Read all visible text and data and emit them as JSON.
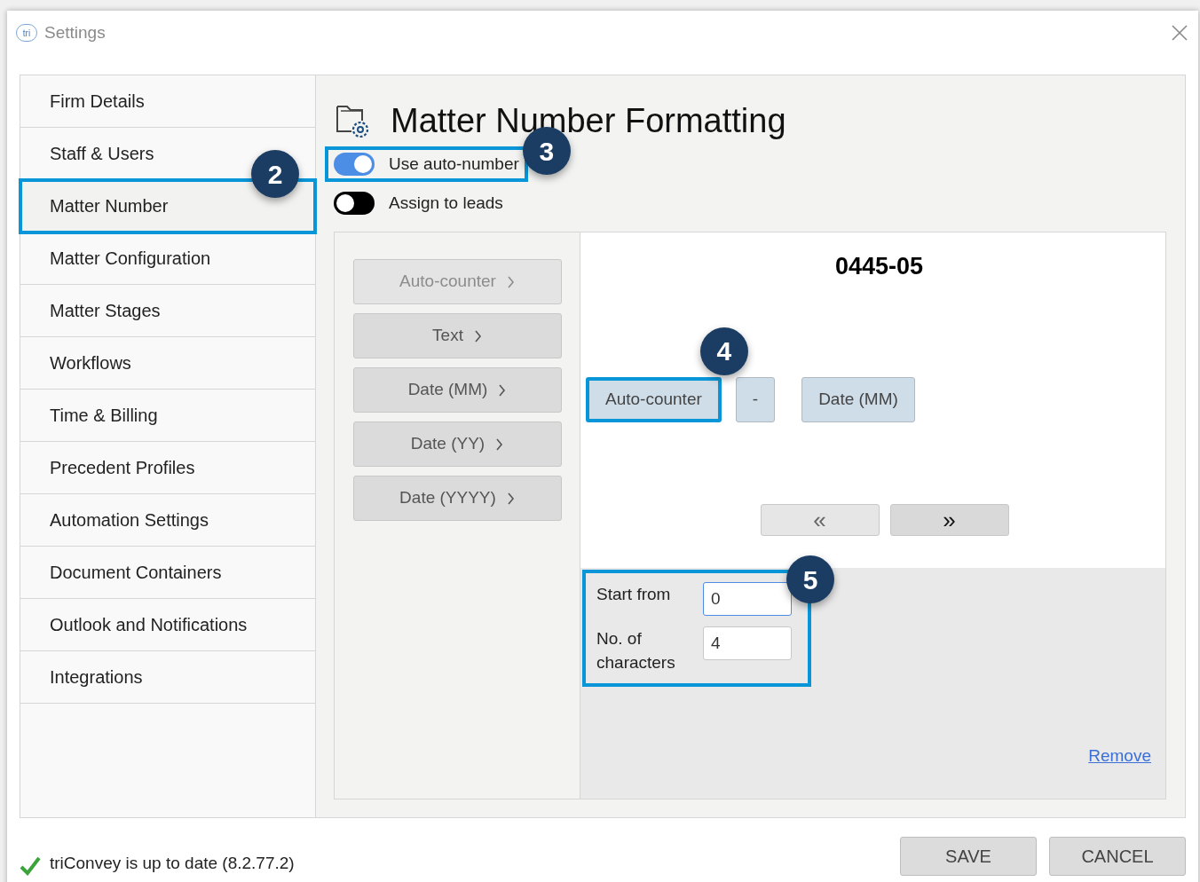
{
  "window": {
    "logo_text": "tri",
    "title": "Settings"
  },
  "sidebar": {
    "items": [
      {
        "label": "Firm Details",
        "selected": false
      },
      {
        "label": "Staff & Users",
        "selected": false
      },
      {
        "label": "Matter Number",
        "selected": true,
        "callout": "2"
      },
      {
        "label": "Matter Configuration",
        "selected": false
      },
      {
        "label": "Matter Stages",
        "selected": false
      },
      {
        "label": "Workflows",
        "selected": false
      },
      {
        "label": "Time & Billing",
        "selected": false
      },
      {
        "label": "Precedent Profiles",
        "selected": false
      },
      {
        "label": "Automation Settings",
        "selected": false
      },
      {
        "label": "Document Containers",
        "selected": false
      },
      {
        "label": "Outlook and Notifications",
        "selected": false
      },
      {
        "label": "Integrations",
        "selected": false
      }
    ]
  },
  "header": {
    "title": "Matter Number Formatting"
  },
  "toggles": [
    {
      "label": "Use auto-number",
      "on": true,
      "callout": "3"
    },
    {
      "label": "Assign to leads",
      "on": false
    }
  ],
  "palette": [
    {
      "label": "Auto-counter",
      "disabled": true
    },
    {
      "label": "Text",
      "disabled": false
    },
    {
      "label": "Date (MM)",
      "disabled": false
    },
    {
      "label": "Date (YY)",
      "disabled": false
    },
    {
      "label": "Date (YYYY)",
      "disabled": false
    }
  ],
  "preview": "0445-05",
  "segments": [
    {
      "label": "Auto-counter",
      "selected": true,
      "callout": "4"
    },
    {
      "label": "-",
      "selected": false
    },
    {
      "label": "Date (MM)",
      "selected": false
    }
  ],
  "move_buttons": [
    {
      "label": "«",
      "disabled": true
    },
    {
      "label": "»",
      "disabled": false
    }
  ],
  "counter_settings": {
    "callout": "5",
    "fields": [
      {
        "label": "Start from",
        "value": "0",
        "focused": true
      },
      {
        "label": "No. of characters",
        "value": "4",
        "focused": false
      }
    ]
  },
  "remove_link": "Remove",
  "status": {
    "text": "triConvey is up to date (8.2.77.2)"
  },
  "buttons": [
    "SAVE",
    "CANCEL"
  ]
}
